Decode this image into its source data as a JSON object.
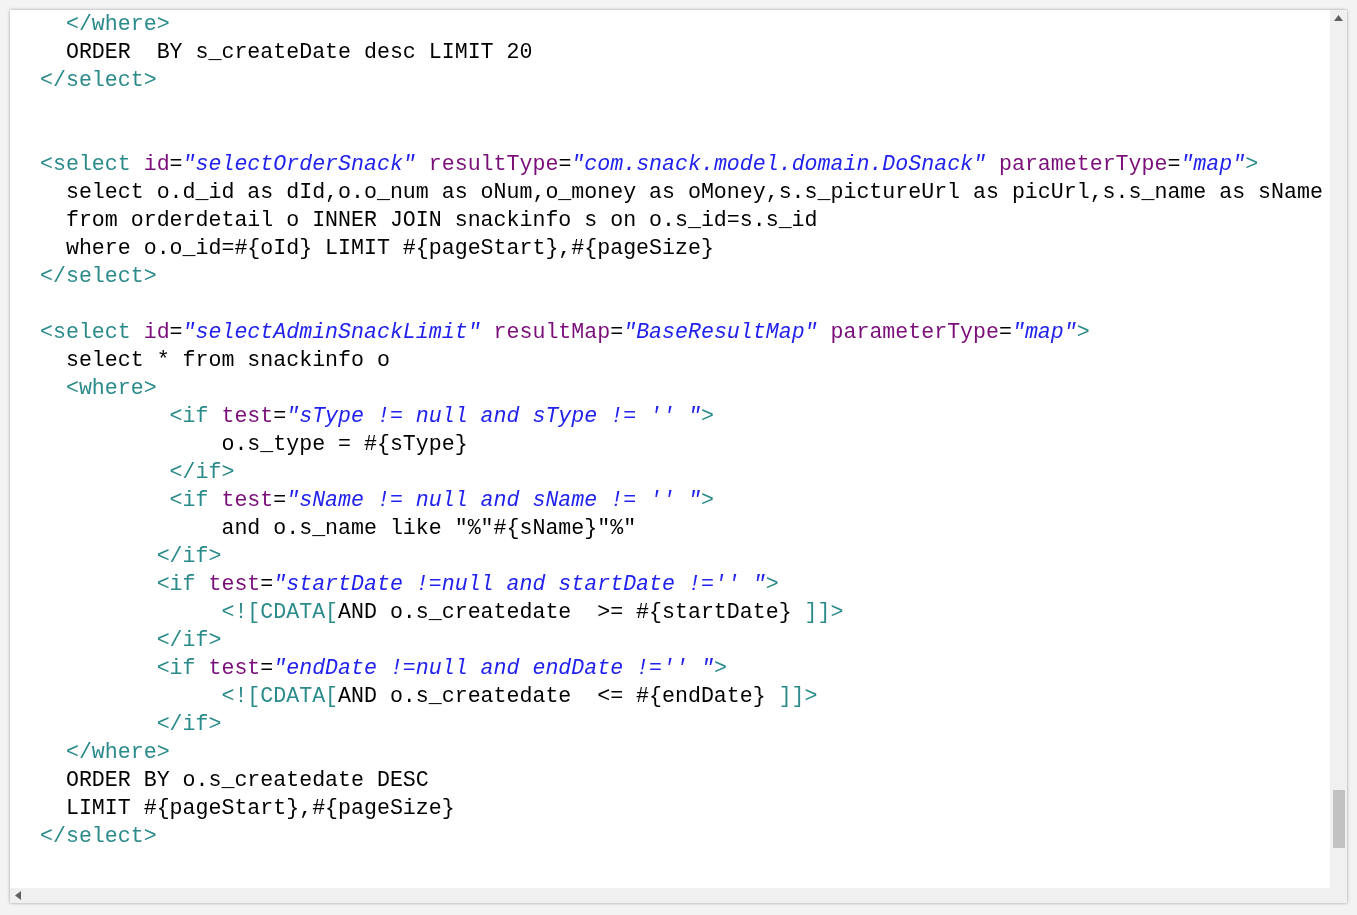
{
  "editor": {
    "lines": [
      {
        "kind": "code",
        "tokens": [
          {
            "kind": "tag",
            "text": "  </where>"
          }
        ]
      },
      {
        "kind": "code",
        "tokens": [
          {
            "kind": "text",
            "text": "  ORDER  BY s_createDate desc LIMIT 20"
          }
        ]
      },
      {
        "kind": "code",
        "tokens": [
          {
            "kind": "tag",
            "text": "</select>"
          }
        ]
      },
      {
        "kind": "blank"
      },
      {
        "kind": "blank"
      },
      {
        "kind": "code",
        "tokens": [
          {
            "kind": "tag",
            "text": "<select "
          },
          {
            "kind": "attr",
            "text": "id"
          },
          {
            "kind": "text",
            "text": "="
          },
          {
            "kind": "value",
            "text": "\"selectOrderSnack\""
          },
          {
            "kind": "attr",
            "text": " resultType"
          },
          {
            "kind": "text",
            "text": "="
          },
          {
            "kind": "value",
            "text": "\"com.snack.model.domain.DoSnack\""
          },
          {
            "kind": "attr",
            "text": " parameterType"
          },
          {
            "kind": "text",
            "text": "="
          },
          {
            "kind": "value",
            "text": "\"map\""
          },
          {
            "kind": "tag",
            "text": ">"
          }
        ]
      },
      {
        "kind": "code",
        "tokens": [
          {
            "kind": "text",
            "text": "  select o.d_id as dId,o.o_num as oNum,o_money as oMoney,s.s_pictureUrl as picUrl,s.s_name as sName"
          }
        ]
      },
      {
        "kind": "code",
        "tokens": [
          {
            "kind": "text",
            "text": "  from orderdetail o INNER JOIN snackinfo s on o.s_id=s.s_id"
          }
        ]
      },
      {
        "kind": "code",
        "tokens": [
          {
            "kind": "text",
            "text": "  where o.o_id=#{oId} LIMIT #{pageStart},#{pageSize}"
          }
        ]
      },
      {
        "kind": "code",
        "tokens": [
          {
            "kind": "tag",
            "text": "</select>"
          }
        ]
      },
      {
        "kind": "blank"
      },
      {
        "kind": "code",
        "tokens": [
          {
            "kind": "tag",
            "text": "<select "
          },
          {
            "kind": "attr",
            "text": "id"
          },
          {
            "kind": "text",
            "text": "="
          },
          {
            "kind": "value",
            "text": "\"selectAdminSnackLimit\""
          },
          {
            "kind": "attr",
            "text": " resultMap"
          },
          {
            "kind": "text",
            "text": "="
          },
          {
            "kind": "value",
            "text": "\"BaseResultMap\""
          },
          {
            "kind": "attr",
            "text": " parameterType"
          },
          {
            "kind": "text",
            "text": "="
          },
          {
            "kind": "value",
            "text": "\"map\""
          },
          {
            "kind": "tag",
            "text": ">"
          }
        ]
      },
      {
        "kind": "code",
        "tokens": [
          {
            "kind": "text",
            "text": "  select * from snackinfo o"
          }
        ]
      },
      {
        "kind": "code",
        "tokens": [
          {
            "kind": "tag",
            "text": "  <where>"
          }
        ]
      },
      {
        "kind": "code",
        "tokens": [
          {
            "kind": "tag",
            "text": "          <if "
          },
          {
            "kind": "attr",
            "text": "test"
          },
          {
            "kind": "text",
            "text": "="
          },
          {
            "kind": "value",
            "text": "\"sType != null and sType != '' \""
          },
          {
            "kind": "tag",
            "text": ">"
          }
        ]
      },
      {
        "kind": "code",
        "tokens": [
          {
            "kind": "text",
            "text": "              o.s_type = #{sType}"
          }
        ]
      },
      {
        "kind": "code",
        "tokens": [
          {
            "kind": "tag",
            "text": "          </if>"
          }
        ]
      },
      {
        "kind": "code",
        "tokens": [
          {
            "kind": "tag",
            "text": "          <if "
          },
          {
            "kind": "attr",
            "text": "test"
          },
          {
            "kind": "text",
            "text": "="
          },
          {
            "kind": "value",
            "text": "\"sName != null and sName != '' \""
          },
          {
            "kind": "tag",
            "text": ">"
          }
        ]
      },
      {
        "kind": "code",
        "tokens": [
          {
            "kind": "text",
            "text": "              and o.s_name like \"%\"#{sName}\"%\""
          }
        ]
      },
      {
        "kind": "code",
        "tokens": [
          {
            "kind": "tag",
            "text": "         </if>"
          }
        ]
      },
      {
        "kind": "code",
        "tokens": [
          {
            "kind": "tag",
            "text": "         <if "
          },
          {
            "kind": "attr",
            "text": "test"
          },
          {
            "kind": "text",
            "text": "="
          },
          {
            "kind": "value",
            "text": "\"startDate !=null and startDate !='' \""
          },
          {
            "kind": "tag",
            "text": ">"
          }
        ]
      },
      {
        "kind": "code",
        "tokens": [
          {
            "kind": "tag",
            "text": "              <![CDATA["
          },
          {
            "kind": "text",
            "text": "AND o.s_createdate  >= #{startDate} "
          },
          {
            "kind": "tag",
            "text": "]]>"
          }
        ]
      },
      {
        "kind": "code",
        "tokens": [
          {
            "kind": "tag",
            "text": "         </if>"
          }
        ]
      },
      {
        "kind": "code",
        "tokens": [
          {
            "kind": "tag",
            "text": "         <if "
          },
          {
            "kind": "attr",
            "text": "test"
          },
          {
            "kind": "text",
            "text": "="
          },
          {
            "kind": "value",
            "text": "\"endDate !=null and endDate !='' \""
          },
          {
            "kind": "tag",
            "text": ">"
          }
        ]
      },
      {
        "kind": "code",
        "tokens": [
          {
            "kind": "tag",
            "text": "              <![CDATA["
          },
          {
            "kind": "text",
            "text": "AND o.s_createdate  <= #{endDate} "
          },
          {
            "kind": "tag",
            "text": "]]>"
          }
        ]
      },
      {
        "kind": "code",
        "tokens": [
          {
            "kind": "tag",
            "text": "         </if>"
          }
        ]
      },
      {
        "kind": "code",
        "tokens": [
          {
            "kind": "tag",
            "text": "  </where>"
          }
        ]
      },
      {
        "kind": "code",
        "tokens": [
          {
            "kind": "text",
            "text": "  ORDER BY o.s_createdate DESC"
          }
        ]
      },
      {
        "kind": "code",
        "tokens": [
          {
            "kind": "text",
            "text": "  LIMIT #{pageStart},#{pageSize}"
          }
        ]
      },
      {
        "kind": "code",
        "tokens": [
          {
            "kind": "tag",
            "text": "</select>"
          }
        ]
      }
    ]
  }
}
